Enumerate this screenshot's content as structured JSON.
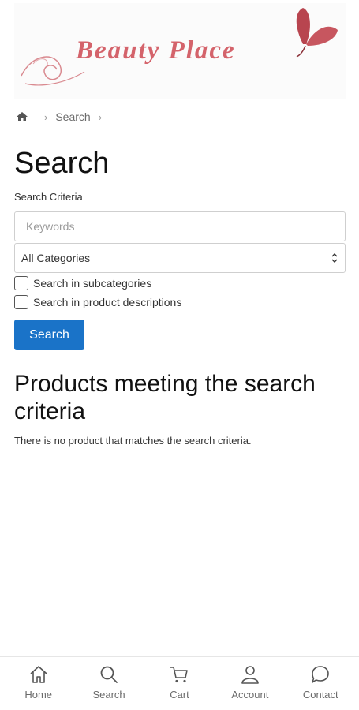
{
  "header": {
    "logo_text": "Beauty Place"
  },
  "breadcrumb": {
    "home_icon": "home-icon",
    "current": "Search"
  },
  "page": {
    "title": "Search",
    "criteria_label": "Search Criteria"
  },
  "form": {
    "keywords_placeholder": "Keywords",
    "keywords_value": "",
    "category_selected": "All Categories",
    "subcategories_label": "Search in subcategories",
    "subcategories_checked": false,
    "descriptions_label": "Search in product descriptions",
    "descriptions_checked": false,
    "search_button_label": "Search"
  },
  "results": {
    "heading": "Products meeting the search criteria",
    "message": "There is no product that matches the search criteria."
  },
  "bottom_nav": {
    "home": "Home",
    "search": "Search",
    "cart": "Cart",
    "account": "Account",
    "contact": "Contact"
  },
  "colors": {
    "brand_pink": "#d4636b",
    "butterfly": "#b8454f",
    "primary_button": "#1a73c8"
  }
}
